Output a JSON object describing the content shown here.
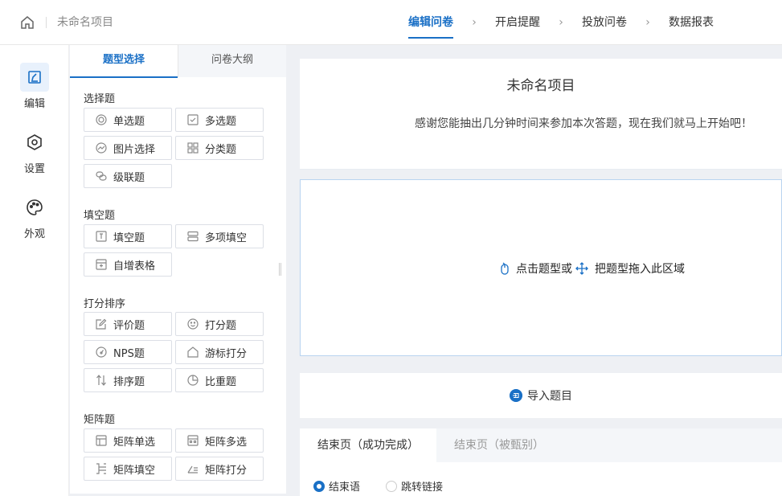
{
  "header": {
    "project_title": "未命名项目",
    "steps": [
      {
        "label": "编辑问卷",
        "active": true
      },
      {
        "label": "开启提醒",
        "active": false
      },
      {
        "label": "投放问卷",
        "active": false
      },
      {
        "label": "数据报表",
        "active": false
      }
    ],
    "step_separator": "›"
  },
  "rail": {
    "items": [
      {
        "label": "编辑",
        "icon": "edit-icon",
        "active": true
      },
      {
        "label": "设置",
        "icon": "settings-icon",
        "active": false
      },
      {
        "label": "外观",
        "icon": "palette-icon",
        "active": false
      }
    ]
  },
  "panel": {
    "tabs": [
      "题型选择",
      "问卷大纲"
    ],
    "groups": [
      {
        "title": "选择题",
        "items": [
          "单选题",
          "多选题",
          "图片选择",
          "分类题",
          "级联题"
        ]
      },
      {
        "title": "填空题",
        "items": [
          "填空题",
          "多项填空",
          "自增表格"
        ]
      },
      {
        "title": "打分排序",
        "items": [
          "评价题",
          "打分题",
          "NPS题",
          "游标打分",
          "排序题",
          "比重题"
        ]
      },
      {
        "title": "矩阵题",
        "items": [
          "矩阵单选",
          "矩阵多选",
          "矩阵填空",
          "矩阵打分"
        ]
      }
    ]
  },
  "canvas": {
    "survey_title": "未命名项目",
    "survey_desc": "感谢您能抽出几分钟时间来参加本次答题，现在我们就马上开始吧！",
    "dropzone": {
      "part1": "点击题型或",
      "part2": "把题型拖入此区域"
    },
    "import_label": "导入题目",
    "end_tabs": [
      "结束页（成功完成）",
      "结束页（被甄别）"
    ],
    "end_options": [
      {
        "label": "结束语",
        "selected": true
      },
      {
        "label": "跳转链接",
        "selected": false
      }
    ]
  },
  "colors": {
    "accent": "#1a70c6",
    "background": "#eef0f4"
  }
}
